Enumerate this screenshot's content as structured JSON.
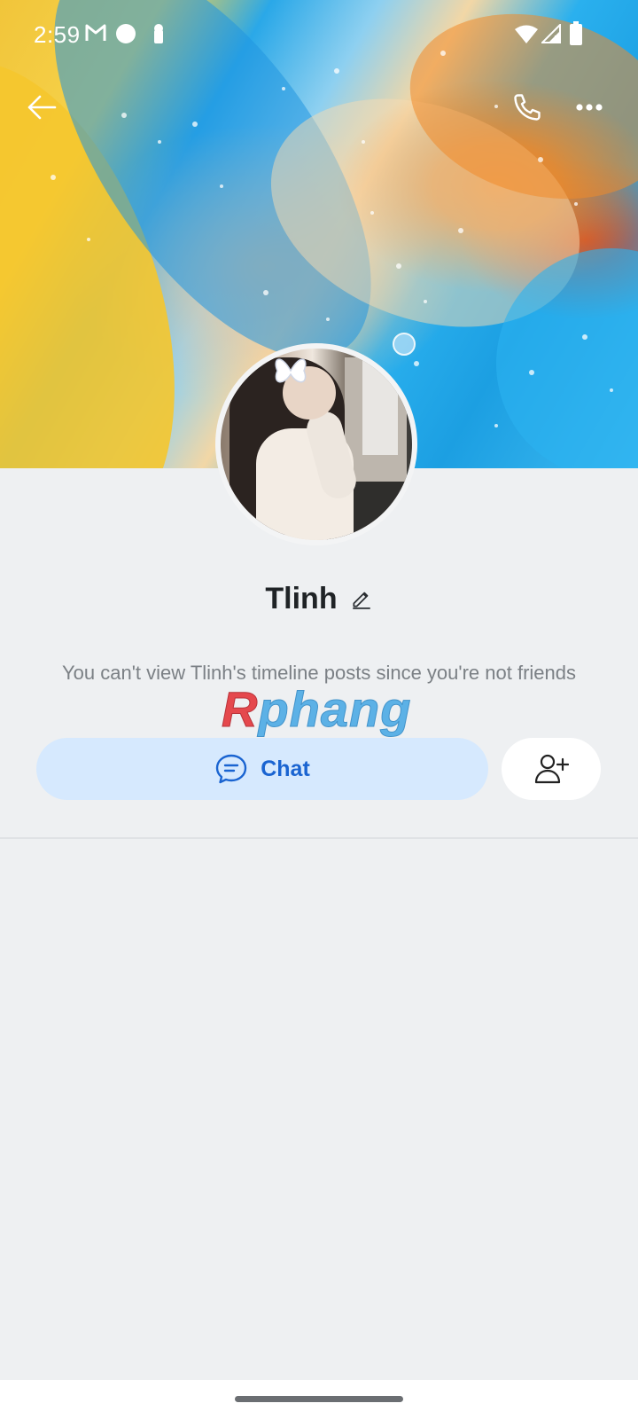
{
  "status_bar": {
    "time": "2:59"
  },
  "profile": {
    "name": "Tlinh",
    "notice": "You can't view Tlinh's timeline posts since you're not friends"
  },
  "actions": {
    "chat_label": "Chat"
  },
  "watermark": {
    "first_letter": "R",
    "rest": "phang"
  },
  "icons": {
    "back": "arrow-left-icon",
    "call": "phone-icon",
    "more": "more-dots-icon",
    "edit": "pencil-icon",
    "chat": "chat-bubble-icon",
    "add_friend": "add-user-icon"
  },
  "colors": {
    "accent": "#1a64d1",
    "chat_button_bg": "#d6e9fe",
    "page_bg": "#eef0f2"
  }
}
